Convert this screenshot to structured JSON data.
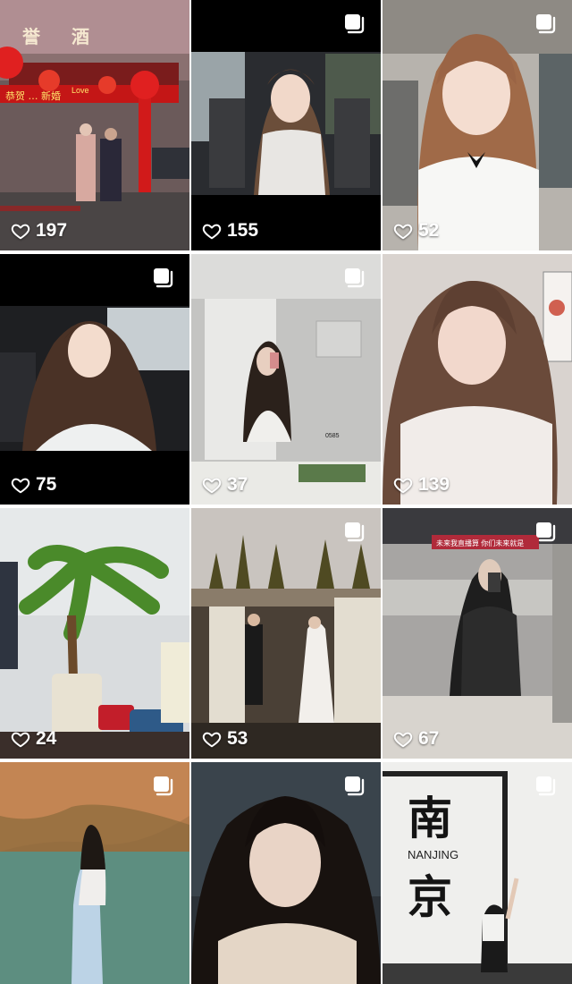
{
  "grid": {
    "posts": [
      {
        "likes": "197",
        "multi_image": false,
        "scene": "wedding-street"
      },
      {
        "likes": "155",
        "multi_image": true,
        "scene": "car-selfie"
      },
      {
        "likes": "52",
        "multi_image": true,
        "scene": "indoor-portrait"
      },
      {
        "likes": "75",
        "multi_image": true,
        "scene": "car-portrait"
      },
      {
        "likes": "37",
        "multi_image": true,
        "scene": "mirror-selfie"
      },
      {
        "likes": "139",
        "multi_image": false,
        "scene": "closeup-portrait"
      },
      {
        "likes": "24",
        "multi_image": false,
        "scene": "office-plant"
      },
      {
        "likes": "53",
        "multi_image": true,
        "scene": "wedding-photoshoot"
      },
      {
        "likes": "67",
        "multi_image": true,
        "scene": "mall-mirror-selfie"
      },
      {
        "likes": "",
        "multi_image": true,
        "scene": "lake-cliff"
      },
      {
        "likes": "",
        "multi_image": true,
        "scene": "night-portrait"
      },
      {
        "likes": "",
        "multi_image": true,
        "scene": "nanjing-wall"
      }
    ],
    "signs": {
      "wedding_banner": "恭贺 … 新婚",
      "wedding_top_left": "誉",
      "wedding_top_right": "酒",
      "wedding_love": "Love",
      "mall_banner": "未来我直播算 你们未来就是",
      "nanjing_char_top": "南",
      "nanjing_latin": "NANJING",
      "nanjing_char_bottom": "京",
      "mirror_time": "0585"
    }
  },
  "icons": {
    "like": "heart-outline-icon",
    "multi": "multiple-photos-icon"
  },
  "colors": {
    "text": "#ffffff",
    "background": "#ffffff"
  }
}
